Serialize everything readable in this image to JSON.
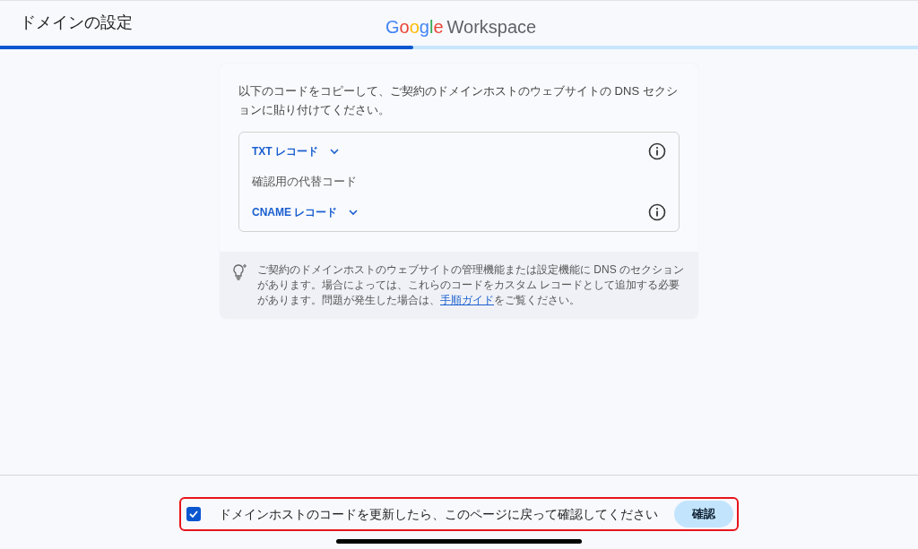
{
  "header": {
    "title": "ドメインの設定",
    "logo": {
      "brand": "Google",
      "product": "Workspace"
    }
  },
  "progress": {
    "level": 0.45
  },
  "card": {
    "instruction": "以下のコードをコピーして、ご契約のドメインホストのウェブサイトの DNS セクションに貼り付けてください。",
    "records": [
      {
        "kind": "dropdown",
        "label": "TXT レコード",
        "expanded": false
      },
      {
        "kind": "text",
        "label": "確認用の代替コード"
      },
      {
        "kind": "dropdown",
        "label": "CNAME レコード",
        "expanded": false
      }
    ],
    "tip": {
      "before": "ご契約のドメインホストのウェブサイトの管理機能または設定機能に DNS のセクションがあります。場合によっては、これらのコードをカスタム レコードとして追加する必要があります。問題が発生した場合は、",
      "link": "手順ガイド",
      "after": "をご覧ください。"
    }
  },
  "footer": {
    "checkbox": {
      "label": "ドメインホストのコードを更新したら、このページに戻って確認してください",
      "checked": true
    },
    "button": "確認"
  }
}
